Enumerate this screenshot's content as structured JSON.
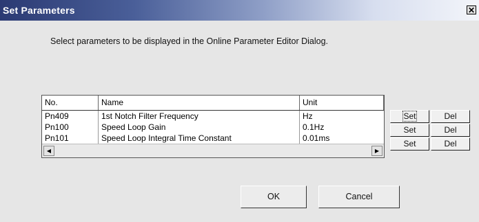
{
  "window": {
    "title": "Set Parameters",
    "close_glyph": "✕"
  },
  "instruction": "Select parameters to be displayed in the Online Parameter Editor Dialog.",
  "table": {
    "columns": [
      "No.",
      "Name",
      "Unit"
    ],
    "rows": [
      {
        "no": "Pn409",
        "name": "1st Notch Filter Frequency",
        "unit": "Hz"
      },
      {
        "no": "Pn100",
        "name": "Speed Loop Gain",
        "unit": "0.1Hz"
      },
      {
        "no": "Pn101",
        "name": "Speed Loop Integral Time Constant",
        "unit": "0.01ms"
      }
    ],
    "scroll_left_glyph": "◀",
    "scroll_right_glyph": "▶"
  },
  "row_buttons": {
    "set_label": "Set",
    "del_label": "Del"
  },
  "footer": {
    "ok_label": "OK",
    "cancel_label": "Cancel"
  }
}
